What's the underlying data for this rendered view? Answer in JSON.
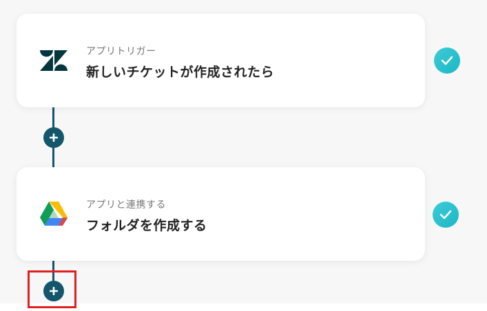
{
  "steps": [
    {
      "app": "Zendesk",
      "icon": "zendesk-icon",
      "subtitle": "アプリトリガー",
      "title": "新しいチケットが作成されたら",
      "status": "completed"
    },
    {
      "app": "Google Drive",
      "icon": "google-drive-icon",
      "subtitle": "アプリと連携する",
      "title": "フォルダを作成する",
      "status": "completed"
    }
  ],
  "colors": {
    "connector": "#14566b",
    "check": "#2cc0cd",
    "highlight": "#e02020",
    "zendesk": "#03363d"
  }
}
